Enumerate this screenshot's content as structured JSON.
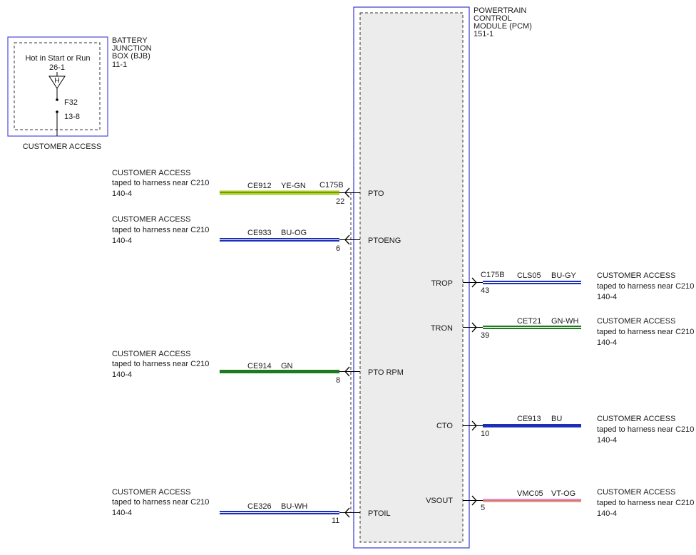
{
  "bjb": {
    "title_lines": [
      "BATTERY",
      "JUNCTION",
      "BOX (BJB)",
      "11-1"
    ],
    "hot_label": "Hot in Start or Run",
    "hot_ref": "26-1",
    "fuse_symbol": "H",
    "fuse": "F32",
    "pin": "13-8",
    "caption": "CUSTOMER ACCESS"
  },
  "pcm": {
    "title_lines": [
      "POWERTRAIN",
      "CONTROL",
      "MODULE (PCM)",
      "151-1"
    ]
  },
  "access_note": [
    "CUSTOMER ACCESS",
    "taped to harness near C210",
    "140-4"
  ],
  "left_circuits": [
    {
      "circuit": "CE912",
      "color_code": "YE-GN",
      "connector": "C175B",
      "pin": "22",
      "signal": "PTO",
      "stripe_main": "#c8d400",
      "stripe_trace": "#2e8b1e"
    },
    {
      "circuit": "CE933",
      "color_code": "BU-OG",
      "connector": "",
      "pin": "6",
      "signal": "PTOENG",
      "stripe_main": "#1c2fb8",
      "stripe_trace": "#1c2fb8"
    },
    {
      "circuit": "CE914",
      "color_code": "GN",
      "connector": "",
      "pin": "8",
      "signal": "PTO RPM",
      "stripe_main": "#1e7a1e",
      "stripe_trace": "#1e7a1e"
    },
    {
      "circuit": "CE326",
      "color_code": "BU-WH",
      "connector": "",
      "pin": "11",
      "signal": "PTOIL",
      "stripe_main": "#1c2fb8",
      "stripe_trace": "#1c2fb8"
    }
  ],
  "right_circuits": [
    {
      "signal": "TROP",
      "connector": "C175B",
      "circuit": "CLS05",
      "color_code": "BU-GY",
      "pin": "43",
      "stripe_main": "#1c2fb8",
      "stripe_trace": "#1c2fb8"
    },
    {
      "signal": "TRON",
      "connector": "",
      "circuit": "CET21",
      "color_code": "GN-WH",
      "pin": "39",
      "stripe_main": "#1e7a1e",
      "stripe_trace": "#1e7a1e"
    },
    {
      "signal": "CTO",
      "connector": "",
      "circuit": "CE913",
      "color_code": "BU",
      "pin": "10",
      "stripe_main": "#1c2fb8",
      "stripe_trace": "#1c2fb8"
    },
    {
      "signal": "VSOUT",
      "connector": "",
      "circuit": "VMC05",
      "color_code": "VT-OG",
      "pin": "5",
      "stripe_main": "#e58fc6",
      "stripe_trace": "#e58fc6"
    }
  ],
  "colors": {
    "module_border": "#3a3ad0",
    "module_fill": "#ececec",
    "bjb_border": "#4a4ad8"
  }
}
